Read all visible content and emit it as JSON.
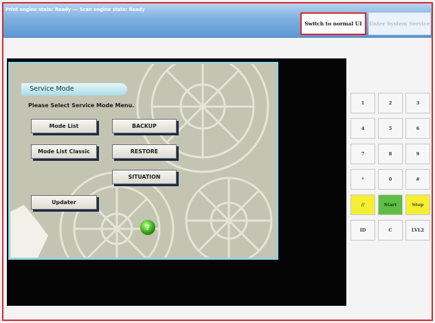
{
  "header": {
    "status_text": "Print engine state: Ready  ---  Scan engine state: Ready",
    "switch_label": "Switch to normal UI",
    "system_service_label": "Enter System Service"
  },
  "service_mode": {
    "title": "Service Mode",
    "prompt": "Please Select Service Mode Menu.",
    "buttons": {
      "mode_list": "Mode List",
      "backup": "BACKUP",
      "mode_list_classic": "Mode List Classic",
      "restore": "RESTORE",
      "situation": "SITUATION",
      "updater": "Updater"
    }
  },
  "keypad": {
    "keys": [
      "1",
      "2",
      "3",
      "4",
      "5",
      "6",
      "7",
      "8",
      "9",
      "*",
      "0",
      "#",
      "//",
      "Start",
      "Stop",
      "ID",
      "C",
      "LVL2"
    ]
  },
  "colors": {
    "accent_red": "#d8262c",
    "header_blue": "#7fb1e0",
    "key_yellow": "#f4ef33",
    "key_green": "#5fbe45"
  }
}
